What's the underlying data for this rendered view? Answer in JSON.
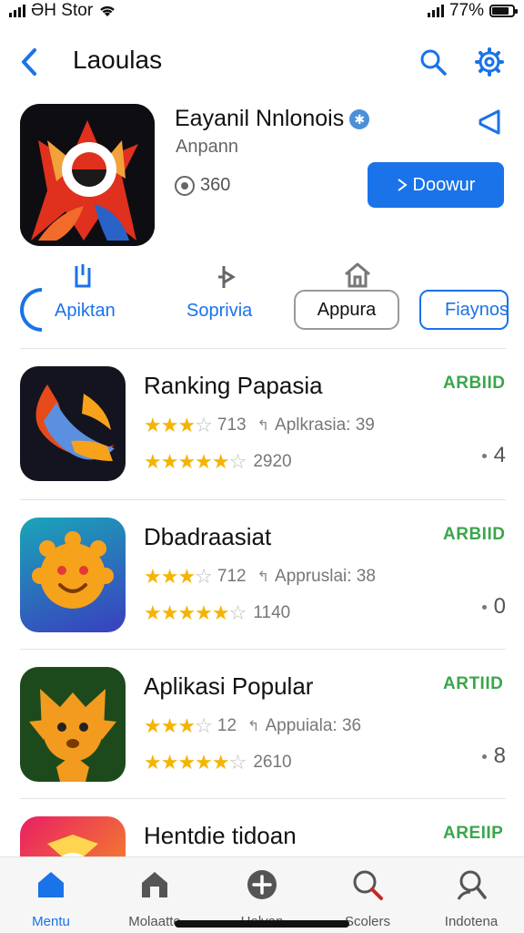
{
  "status": {
    "carrier": "ƏH Stor",
    "battery": "77%"
  },
  "header": {
    "title": "Laoulas"
  },
  "featured": {
    "name": "Eayanil Nnlonois",
    "subtitle": "Anpann",
    "meta": "360",
    "get_label": "Doowur"
  },
  "categories": [
    {
      "label": "Apiktan"
    },
    {
      "label": "Soprivia"
    },
    {
      "label": "Appura"
    },
    {
      "label": "Fiaynos"
    }
  ],
  "apps": [
    {
      "name": "Ranking Papasia",
      "badge": "ARBIID",
      "rating": "713",
      "category": "Aplkrasia: 39",
      "reviews": "2920",
      "count": "4"
    },
    {
      "name": "Dbadraasiat",
      "badge": "ARBIID",
      "rating": "712",
      "category": "Appruslai: 38",
      "reviews": "1140",
      "count": "0"
    },
    {
      "name": "Aplikasi Popular",
      "badge": "ARTIID",
      "rating": "12",
      "category": "Appuiala: 36",
      "reviews": "2610",
      "count": "8"
    },
    {
      "name": "Hentdie tidoan",
      "badge": "AREIIP"
    }
  ],
  "tabs": [
    {
      "label": "Mentu"
    },
    {
      "label": "Molaatte"
    },
    {
      "label": "Helvan"
    },
    {
      "label": "Scolers"
    },
    {
      "label": "Indotena"
    }
  ],
  "colors": {
    "accent": "#1a73e8",
    "badge": "#3aa64b",
    "star": "#f5b400"
  }
}
